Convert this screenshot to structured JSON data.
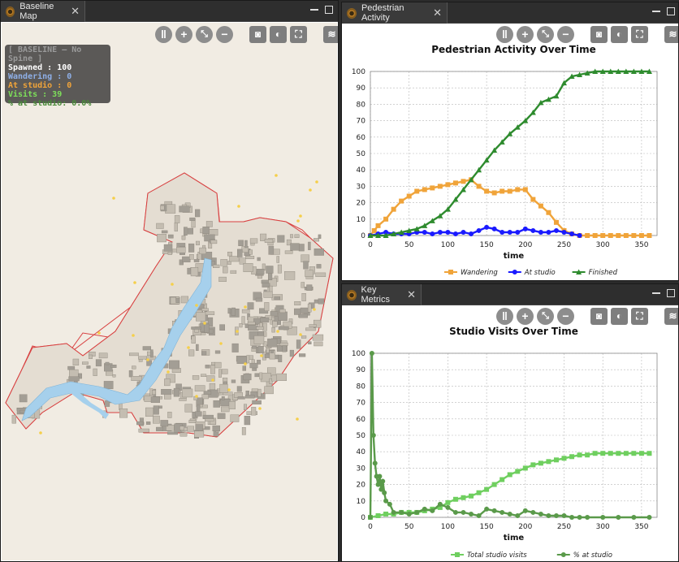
{
  "panels": {
    "map": {
      "tab_title": "Baseline Map"
    },
    "activity": {
      "tab_title": "Pedestrian Activity"
    },
    "metrics": {
      "tab_title": "Key Metrics"
    }
  },
  "toolbar_icons": [
    "pause-icon",
    "zoom-in-icon",
    "fit-icon",
    "zoom-out-icon",
    "camera-icon",
    "contrast-icon",
    "fullscreen-icon",
    "layers-icon"
  ],
  "map_overlay": {
    "header": "[ BASELINE — No Spine ]",
    "spawned": "Spawned    : 100",
    "wandering": "Wandering : 0",
    "at_studio": "At studio : 0",
    "visits": "Visits       : 39",
    "pct_at_studio": "% at studio: 0.0%"
  },
  "colors": {
    "wandering": "#f0a43a",
    "at_studio": "#1a1aff",
    "finished": "#2e8b2e",
    "total_visits": "#6fcf5f",
    "pct_studio": "#5a9a4a",
    "water": "#a6d0ec",
    "outline": "#d84040"
  },
  "chart_data": [
    {
      "type": "line",
      "title": "Pedestrian Activity Over Time",
      "xlabel": "time",
      "ylabel": "",
      "xlim": [
        0,
        370
      ],
      "ylim": [
        0,
        100
      ],
      "xticks": [
        0,
        50,
        100,
        150,
        200,
        250,
        300,
        350
      ],
      "yticks": [
        0,
        10,
        20,
        30,
        40,
        50,
        60,
        70,
        80,
        90,
        100
      ],
      "legend_position": "bottom",
      "series": [
        {
          "name": "Wandering",
          "marker": "square",
          "x": [
            0,
            5,
            10,
            20,
            30,
            40,
            50,
            60,
            70,
            80,
            90,
            100,
            110,
            120,
            130,
            140,
            150,
            160,
            170,
            180,
            190,
            200,
            210,
            220,
            230,
            240,
            250,
            260,
            270,
            280,
            290,
            300,
            310,
            320,
            330,
            340,
            350,
            360
          ],
          "y": [
            0,
            3,
            6,
            10,
            16,
            21,
            24,
            27,
            28,
            29,
            30,
            31,
            32,
            33,
            34,
            30,
            27,
            26,
            27,
            27,
            28,
            28,
            22,
            18,
            14,
            8,
            3,
            1,
            0,
            0,
            0,
            0,
            0,
            0,
            0,
            0,
            0,
            0
          ]
        },
        {
          "name": "At studio",
          "marker": "circle",
          "x": [
            0,
            10,
            20,
            30,
            40,
            50,
            60,
            70,
            80,
            90,
            100,
            110,
            120,
            130,
            140,
            150,
            160,
            170,
            180,
            190,
            200,
            210,
            220,
            230,
            240,
            250,
            260,
            270
          ],
          "y": [
            0,
            1,
            2,
            1,
            1,
            1,
            2,
            2,
            1,
            2,
            2,
            1,
            2,
            1,
            3,
            5,
            4,
            2,
            2,
            2,
            4,
            3,
            2,
            2,
            3,
            2,
            1,
            0
          ]
        },
        {
          "name": "Finished",
          "marker": "triangle",
          "x": [
            0,
            10,
            20,
            30,
            40,
            50,
            60,
            70,
            80,
            90,
            100,
            110,
            120,
            130,
            140,
            150,
            160,
            170,
            180,
            190,
            200,
            210,
            220,
            230,
            240,
            250,
            260,
            270,
            280,
            290,
            300,
            310,
            320,
            330,
            340,
            350,
            360
          ],
          "y": [
            0,
            0,
            0,
            1,
            2,
            3,
            4,
            6,
            9,
            12,
            16,
            22,
            28,
            34,
            40,
            46,
            52,
            57,
            62,
            66,
            70,
            75,
            81,
            83,
            85,
            93,
            97,
            98,
            99,
            100,
            100,
            100,
            100,
            100,
            100,
            100,
            100
          ]
        }
      ]
    },
    {
      "type": "line",
      "title": "Studio Visits Over Time",
      "xlabel": "time",
      "ylabel": "",
      "xlim": [
        0,
        370
      ],
      "ylim": [
        0,
        100
      ],
      "xticks": [
        0,
        50,
        100,
        150,
        200,
        250,
        300,
        350
      ],
      "yticks": [
        0,
        10,
        20,
        30,
        40,
        50,
        60,
        70,
        80,
        90,
        100
      ],
      "legend_position": "bottom",
      "series": [
        {
          "name": "Total studio visits",
          "marker": "square",
          "x": [
            0,
            10,
            20,
            30,
            40,
            50,
            60,
            70,
            80,
            90,
            100,
            110,
            120,
            130,
            140,
            150,
            160,
            170,
            180,
            190,
            200,
            210,
            220,
            230,
            240,
            250,
            260,
            270,
            280,
            290,
            300,
            310,
            320,
            330,
            340,
            350,
            360
          ],
          "y": [
            0,
            1,
            2,
            2,
            3,
            3,
            3,
            4,
            5,
            6,
            9,
            11,
            12,
            13,
            15,
            17,
            20,
            23,
            26,
            28,
            30,
            32,
            33,
            34,
            35,
            36,
            37,
            38,
            38,
            39,
            39,
            39,
            39,
            39,
            39,
            39,
            39
          ]
        },
        {
          "name": "% at studio",
          "marker": "circle",
          "x": [
            0,
            2,
            4,
            6,
            8,
            10,
            12,
            14,
            16,
            18,
            20,
            25,
            30,
            40,
            50,
            60,
            70,
            80,
            90,
            100,
            110,
            120,
            130,
            140,
            150,
            160,
            170,
            180,
            190,
            200,
            210,
            220,
            230,
            240,
            250,
            260,
            270,
            280,
            300,
            320,
            340,
            360
          ],
          "y": [
            0,
            100,
            50,
            33,
            25,
            20,
            25,
            17,
            22,
            15,
            10,
            8,
            3,
            3,
            2,
            3,
            5,
            4,
            8,
            6,
            3,
            3,
            2,
            1,
            5,
            4,
            3,
            2,
            1,
            4,
            3,
            2,
            1,
            1,
            1,
            0,
            0,
            0,
            0,
            0,
            0,
            0
          ]
        }
      ]
    }
  ]
}
